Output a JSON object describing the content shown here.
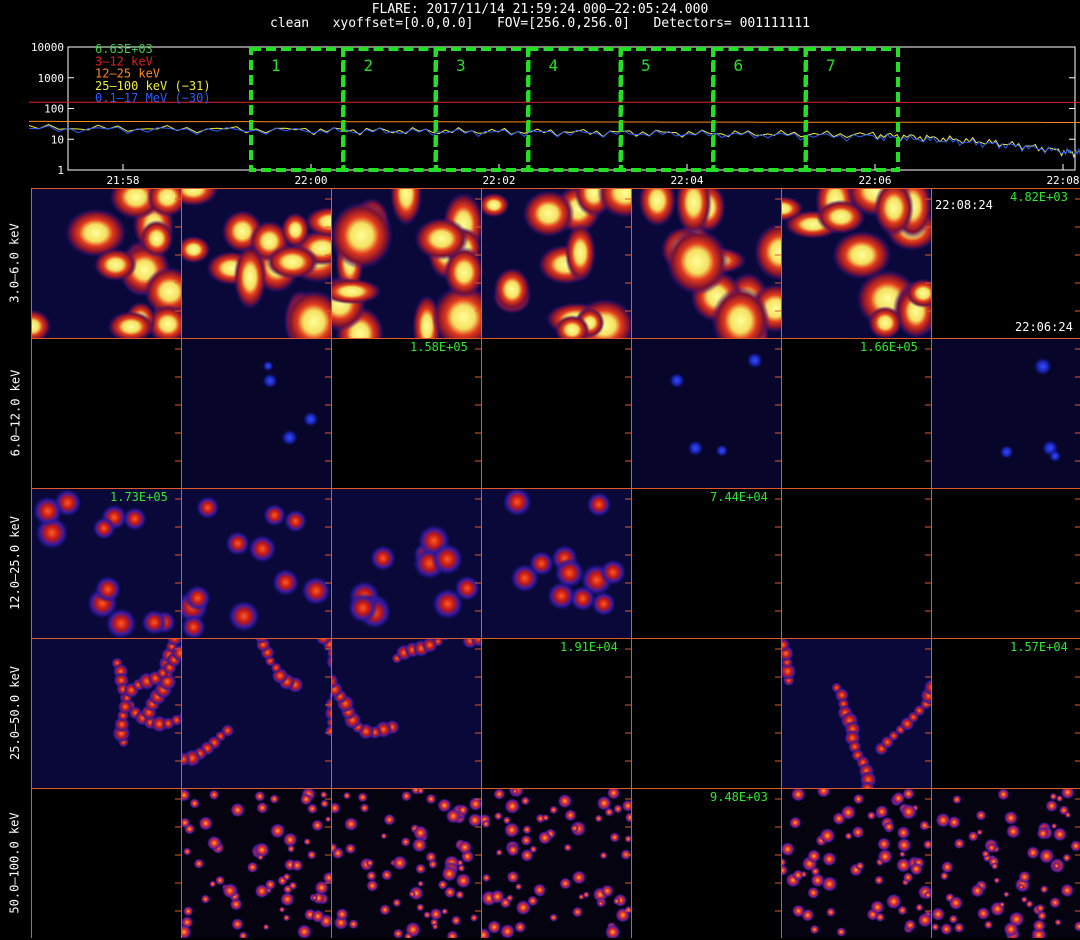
{
  "header": {
    "line1": "FLARE: 2017/11/14 21:59:24.000–22:05:24.000",
    "line2": "clean   xyoffset=[0.0,0.0]   FOV=[256.0,256.0]   Detectors= 001111111"
  },
  "lightcurve": {
    "y_ticks": [
      "10000",
      "1000",
      "100",
      "10",
      "1"
    ],
    "x_ticks": [
      "21:58",
      "22:00",
      "22:02",
      "22:04",
      "22:06",
      "22:08"
    ],
    "legend": [
      {
        "label": "6.63E+03",
        "color": "#3cc83c"
      },
      {
        "label": "3–12 keV",
        "color": "#e32020"
      },
      {
        "label": "12–25 keV",
        "color": "#ff8a1e"
      },
      {
        "label": "25–100 keV (−31)",
        "color": "#f2ee3a"
      },
      {
        "label": "0.1–17 MeV (−30)",
        "color": "#2c5cff"
      }
    ],
    "windows": [
      "1",
      "2",
      "3",
      "4",
      "5",
      "6",
      "7"
    ],
    "colors": {
      "window": "#22e022",
      "axis": "#ffffff",
      "frame": "#e05a2a"
    }
  },
  "chart_data": {
    "type": "line",
    "title": "",
    "xlabel": "",
    "ylabel": "",
    "y_scale": "log",
    "ylim": [
      1,
      10000
    ],
    "x_ticks": [
      "21:58",
      "22:00",
      "22:02",
      "22:04",
      "22:06",
      "22:08"
    ],
    "series": [
      {
        "name": "3–12 keV",
        "color": "#e32020",
        "x": [
          "21:57",
          "22:08:30"
        ],
        "values": [
          160,
          158
        ]
      },
      {
        "name": "12–25 keV",
        "color": "#ff8a1e",
        "x": [
          "21:57",
          "22:08:30"
        ],
        "values": [
          38,
          35
        ]
      },
      {
        "name": "25–100 keV (−31)",
        "color": "#f2ee3a",
        "x": [
          "21:57",
          "22:00",
          "22:02",
          "22:04",
          "22:06",
          "22:07",
          "22:08",
          "22:08:30"
        ],
        "values": [
          24,
          20,
          18,
          16,
          14,
          9,
          4,
          3
        ]
      },
      {
        "name": "0.1–17 MeV (−30)",
        "color": "#2c5cff",
        "x": [
          "21:57",
          "22:00",
          "22:02",
          "22:04",
          "22:06",
          "22:07",
          "22:08",
          "22:08:30"
        ],
        "values": [
          22,
          19,
          17,
          15,
          12,
          8,
          4,
          3
        ]
      }
    ]
  },
  "images": {
    "row_labels": [
      "3.0–6.0 keV",
      "6.0–12.0 keV",
      "12.0–25.0 keV",
      "25.0–50.0 keV",
      "50.0–100.0 keV"
    ],
    "rows": [
      [
        "blob",
        "blob",
        "blob",
        "blob",
        "blob",
        "blob",
        "empty"
      ],
      [
        "empty",
        "dots",
        "empty",
        "empty",
        "dots",
        "empty",
        "dots"
      ],
      [
        "spot",
        "spot",
        "spot",
        "spot",
        "empty",
        "empty",
        "empty"
      ],
      [
        "ring",
        "ring",
        "ring",
        "empty",
        "empty",
        "ring",
        "empty"
      ],
      [
        "empty",
        "speckle",
        "speckle",
        "speckle",
        "empty",
        "speckle",
        "speckle"
      ]
    ],
    "peak_labels": [
      {
        "row": 0,
        "col": 6,
        "text": "4.82E+03"
      },
      {
        "row": 1,
        "col": 2,
        "text": "1.58E+05"
      },
      {
        "row": 1,
        "col": 5,
        "text": "1.66E+05"
      },
      {
        "row": 2,
        "col": 0,
        "text": "1.73E+05"
      },
      {
        "row": 2,
        "col": 4,
        "text": "7.44E+04"
      },
      {
        "row": 3,
        "col": 3,
        "text": "1.91E+04"
      },
      {
        "row": 3,
        "col": 6,
        "text": "1.57E+04"
      },
      {
        "row": 4,
        "col": 4,
        "text": "9.48E+03"
      }
    ],
    "time_labels": {
      "top": "22:08:24",
      "bottom": "22:06:24"
    }
  }
}
